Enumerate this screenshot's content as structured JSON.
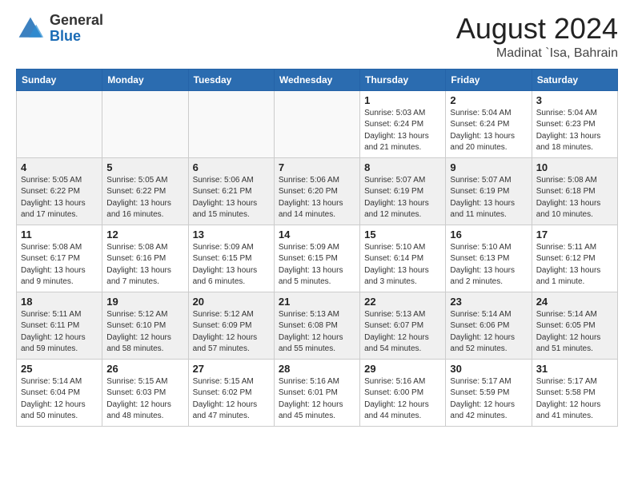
{
  "logo": {
    "text_general": "General",
    "text_blue": "Blue"
  },
  "header": {
    "month_year": "August 2024",
    "location": "Madinat `Isa, Bahrain"
  },
  "weekdays": [
    "Sunday",
    "Monday",
    "Tuesday",
    "Wednesday",
    "Thursday",
    "Friday",
    "Saturday"
  ],
  "weeks": [
    [
      {
        "day": "",
        "empty": true
      },
      {
        "day": "",
        "empty": true
      },
      {
        "day": "",
        "empty": true
      },
      {
        "day": "",
        "empty": true
      },
      {
        "day": "1",
        "sunrise": "5:03 AM",
        "sunset": "6:24 PM",
        "daylight": "13 hours and 21 minutes."
      },
      {
        "day": "2",
        "sunrise": "5:04 AM",
        "sunset": "6:24 PM",
        "daylight": "13 hours and 20 minutes."
      },
      {
        "day": "3",
        "sunrise": "5:04 AM",
        "sunset": "6:23 PM",
        "daylight": "13 hours and 18 minutes."
      }
    ],
    [
      {
        "day": "4",
        "sunrise": "5:05 AM",
        "sunset": "6:22 PM",
        "daylight": "13 hours and 17 minutes."
      },
      {
        "day": "5",
        "sunrise": "5:05 AM",
        "sunset": "6:22 PM",
        "daylight": "13 hours and 16 minutes."
      },
      {
        "day": "6",
        "sunrise": "5:06 AM",
        "sunset": "6:21 PM",
        "daylight": "13 hours and 15 minutes."
      },
      {
        "day": "7",
        "sunrise": "5:06 AM",
        "sunset": "6:20 PM",
        "daylight": "13 hours and 14 minutes."
      },
      {
        "day": "8",
        "sunrise": "5:07 AM",
        "sunset": "6:19 PM",
        "daylight": "13 hours and 12 minutes."
      },
      {
        "day": "9",
        "sunrise": "5:07 AM",
        "sunset": "6:19 PM",
        "daylight": "13 hours and 11 minutes."
      },
      {
        "day": "10",
        "sunrise": "5:08 AM",
        "sunset": "6:18 PM",
        "daylight": "13 hours and 10 minutes."
      }
    ],
    [
      {
        "day": "11",
        "sunrise": "5:08 AM",
        "sunset": "6:17 PM",
        "daylight": "13 hours and 9 minutes."
      },
      {
        "day": "12",
        "sunrise": "5:08 AM",
        "sunset": "6:16 PM",
        "daylight": "13 hours and 7 minutes."
      },
      {
        "day": "13",
        "sunrise": "5:09 AM",
        "sunset": "6:15 PM",
        "daylight": "13 hours and 6 minutes."
      },
      {
        "day": "14",
        "sunrise": "5:09 AM",
        "sunset": "6:15 PM",
        "daylight": "13 hours and 5 minutes."
      },
      {
        "day": "15",
        "sunrise": "5:10 AM",
        "sunset": "6:14 PM",
        "daylight": "13 hours and 3 minutes."
      },
      {
        "day": "16",
        "sunrise": "5:10 AM",
        "sunset": "6:13 PM",
        "daylight": "13 hours and 2 minutes."
      },
      {
        "day": "17",
        "sunrise": "5:11 AM",
        "sunset": "6:12 PM",
        "daylight": "13 hours and 1 minute."
      }
    ],
    [
      {
        "day": "18",
        "sunrise": "5:11 AM",
        "sunset": "6:11 PM",
        "daylight": "12 hours and 59 minutes."
      },
      {
        "day": "19",
        "sunrise": "5:12 AM",
        "sunset": "6:10 PM",
        "daylight": "12 hours and 58 minutes."
      },
      {
        "day": "20",
        "sunrise": "5:12 AM",
        "sunset": "6:09 PM",
        "daylight": "12 hours and 57 minutes."
      },
      {
        "day": "21",
        "sunrise": "5:13 AM",
        "sunset": "6:08 PM",
        "daylight": "12 hours and 55 minutes."
      },
      {
        "day": "22",
        "sunrise": "5:13 AM",
        "sunset": "6:07 PM",
        "daylight": "12 hours and 54 minutes."
      },
      {
        "day": "23",
        "sunrise": "5:14 AM",
        "sunset": "6:06 PM",
        "daylight": "12 hours and 52 minutes."
      },
      {
        "day": "24",
        "sunrise": "5:14 AM",
        "sunset": "6:05 PM",
        "daylight": "12 hours and 51 minutes."
      }
    ],
    [
      {
        "day": "25",
        "sunrise": "5:14 AM",
        "sunset": "6:04 PM",
        "daylight": "12 hours and 50 minutes."
      },
      {
        "day": "26",
        "sunrise": "5:15 AM",
        "sunset": "6:03 PM",
        "daylight": "12 hours and 48 minutes."
      },
      {
        "day": "27",
        "sunrise": "5:15 AM",
        "sunset": "6:02 PM",
        "daylight": "12 hours and 47 minutes."
      },
      {
        "day": "28",
        "sunrise": "5:16 AM",
        "sunset": "6:01 PM",
        "daylight": "12 hours and 45 minutes."
      },
      {
        "day": "29",
        "sunrise": "5:16 AM",
        "sunset": "6:00 PM",
        "daylight": "12 hours and 44 minutes."
      },
      {
        "day": "30",
        "sunrise": "5:17 AM",
        "sunset": "5:59 PM",
        "daylight": "12 hours and 42 minutes."
      },
      {
        "day": "31",
        "sunrise": "5:17 AM",
        "sunset": "5:58 PM",
        "daylight": "12 hours and 41 minutes."
      }
    ]
  ],
  "labels": {
    "sunrise": "Sunrise:",
    "sunset": "Sunset:",
    "daylight": "Daylight:"
  }
}
